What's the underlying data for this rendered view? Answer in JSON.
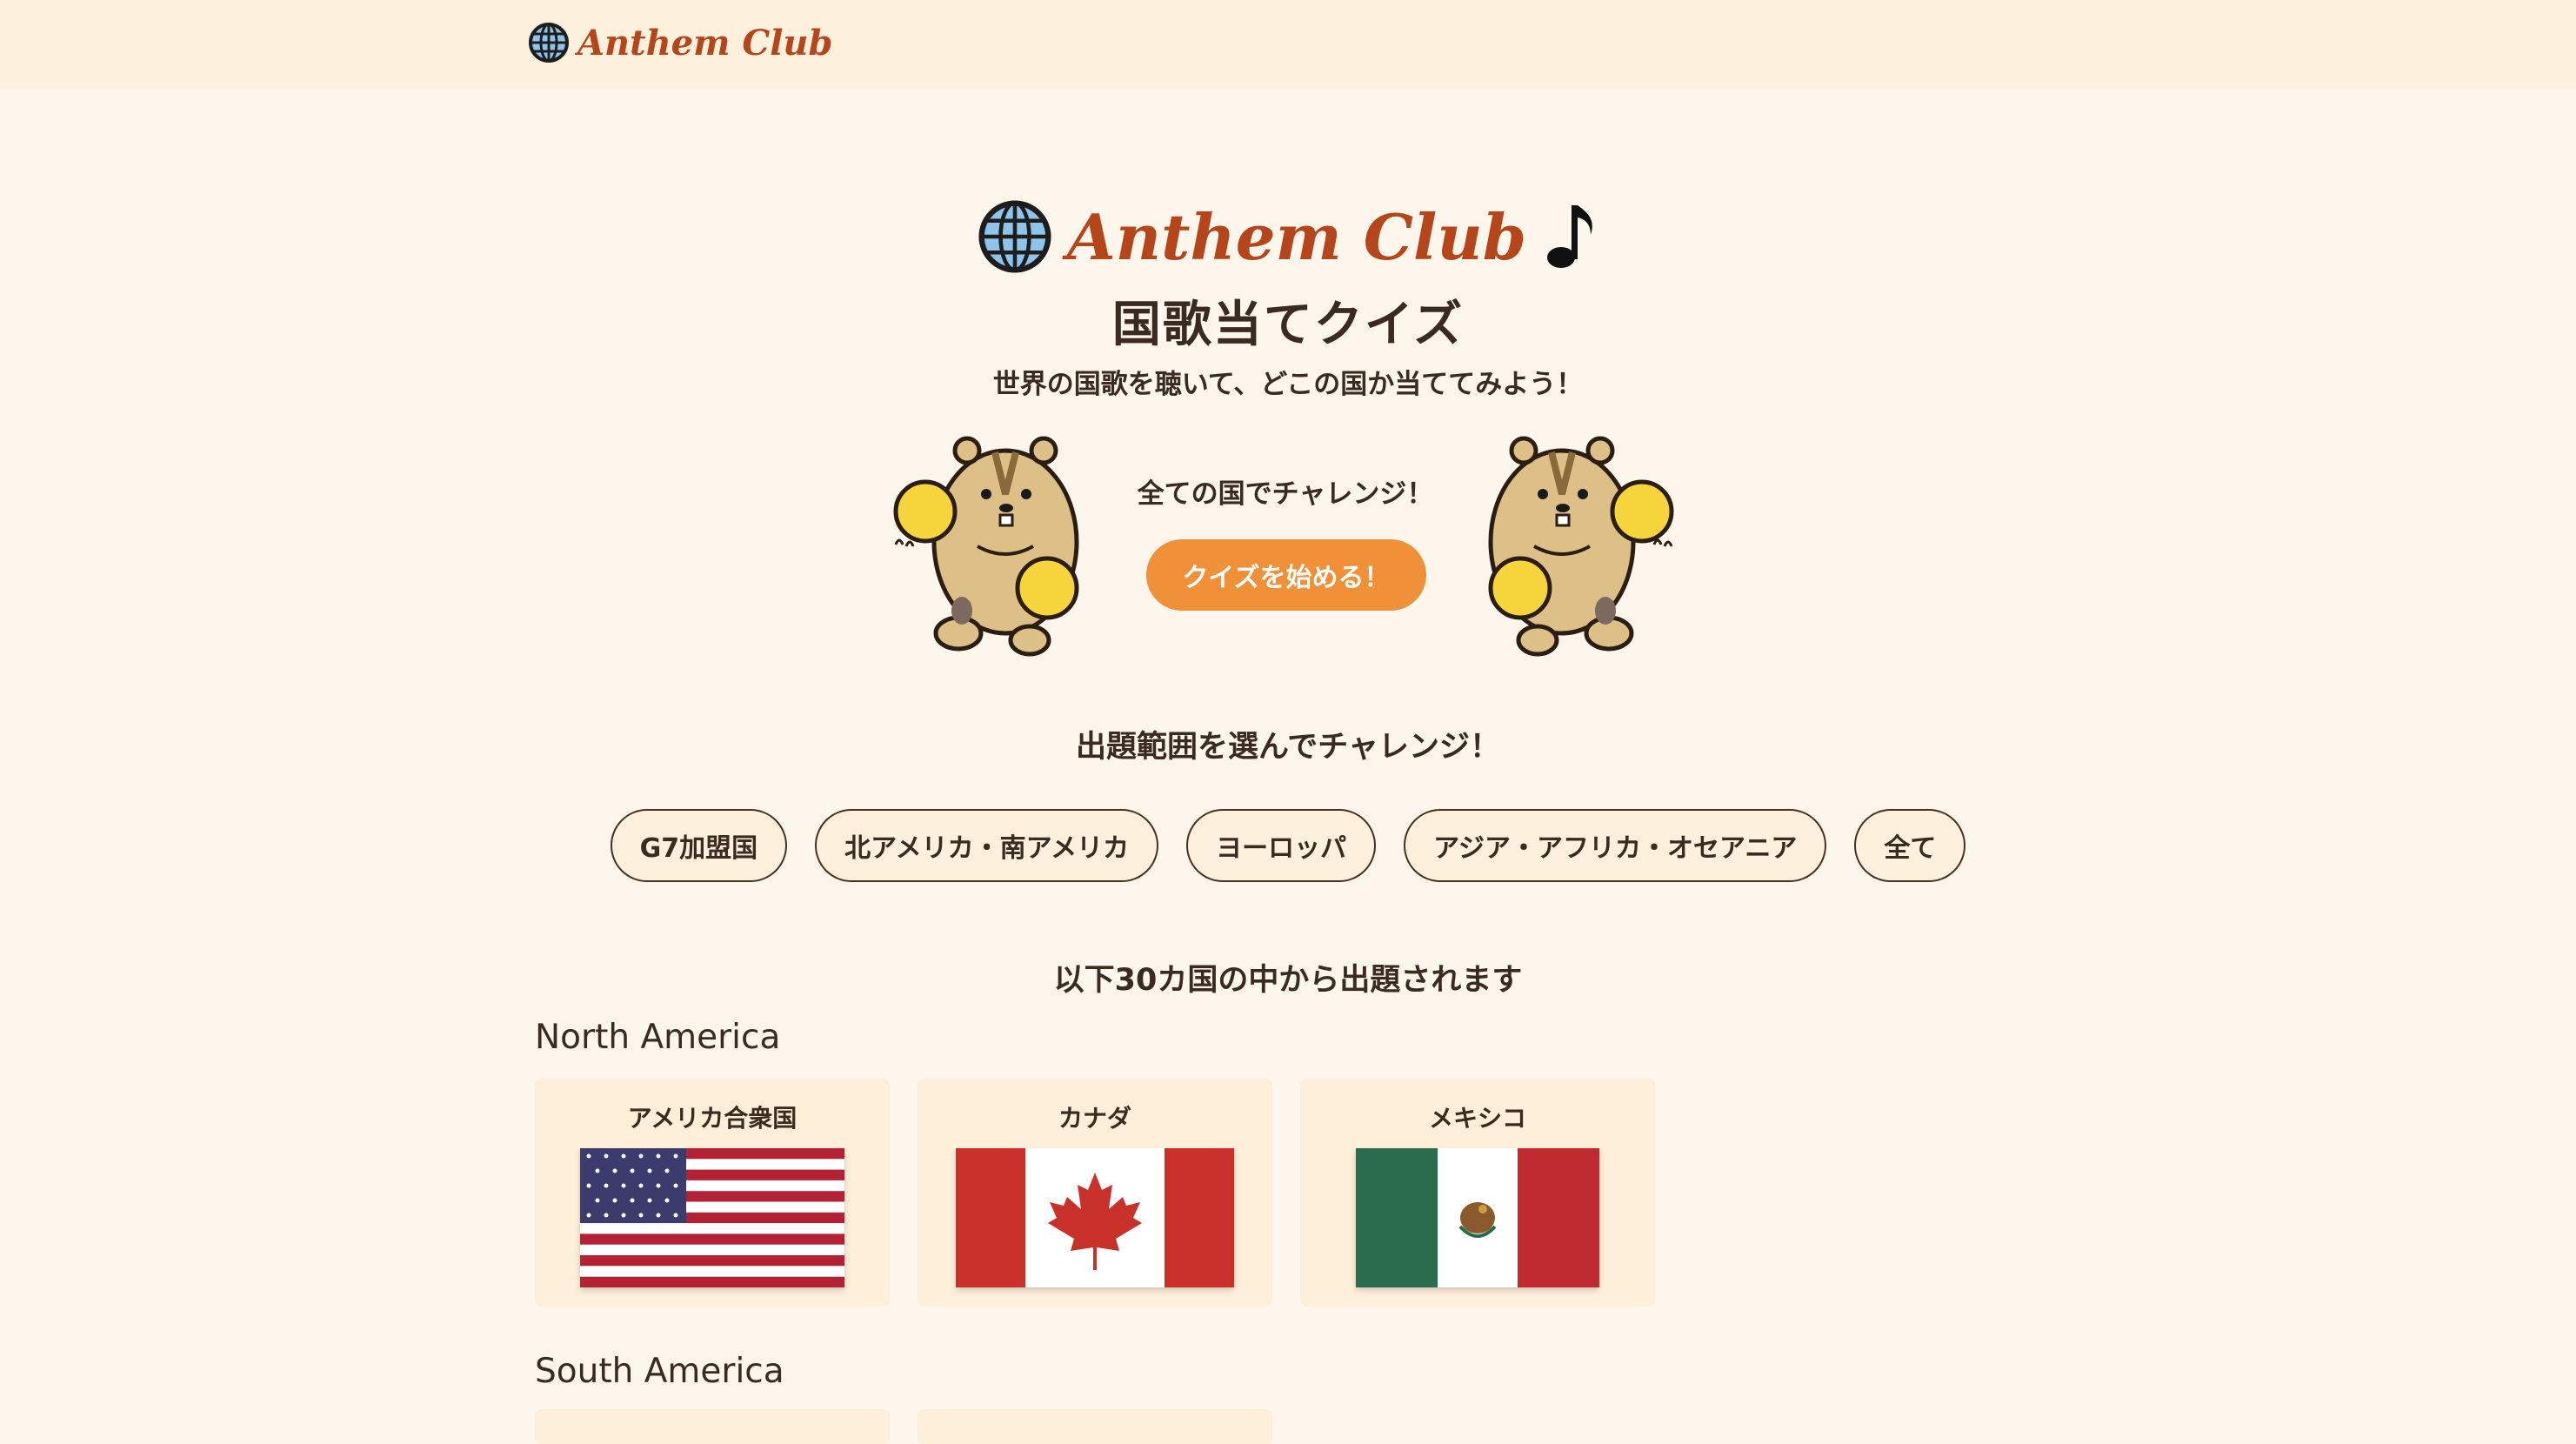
{
  "header": {
    "brand": "Anthem Club",
    "icon": "globe-icon"
  },
  "hero": {
    "title": "Anthem Club",
    "title_icon": "globe-icon",
    "title_trailing_icon": "music-note-icon",
    "subtitle": "国歌当てクイズ",
    "lead": "世界の国歌を聴いて、どこの国か当ててみよう！",
    "challenge_text": "全ての国でチャレンジ！",
    "start_button": "クイズを始める！"
  },
  "range": {
    "title": "出題範囲を選んでチャレンジ！",
    "options": [
      "G7加盟国",
      "北アメリカ・南アメリカ",
      "ヨーロッパ",
      "アジア・アフリカ・オセアニア",
      "全て"
    ]
  },
  "countries": {
    "count_text": "以下30カ国の中から出題されます",
    "regions": [
      {
        "name": "North America",
        "items": [
          {
            "name": "アメリカ合衆国",
            "flag": "us-flag"
          },
          {
            "name": "カナダ",
            "flag": "canada-flag"
          },
          {
            "name": "メキシコ",
            "flag": "mexico-flag"
          }
        ]
      },
      {
        "name": "South America",
        "items": []
      }
    ]
  },
  "colors": {
    "background": "#fdf6ec",
    "header_bg": "#fdf0dc",
    "brand": "#b5461b",
    "accent": "#f0913a",
    "text": "#3b2a1f",
    "card_bg": "#fdefd8"
  }
}
